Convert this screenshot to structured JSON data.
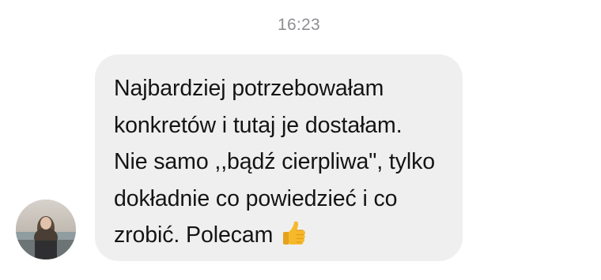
{
  "conversation": {
    "timestamp": "16:23",
    "message": {
      "lines": [
        "Najbardziej potrzebowałam",
        "konkretów i tutaj je dostałam.",
        "Nie samo ,,bądź cierpliwa\", tylko",
        "dokładnie co powiedzieć i co",
        "zrobić. Polecam"
      ],
      "emoji": "thumbs-up-icon"
    },
    "sender": {
      "avatar": "avatar"
    }
  },
  "colors": {
    "bubble_background": "#efefef",
    "timestamp_text": "#8e8e93",
    "message_text": "#141414",
    "emoji_yellow": "#f6b92b"
  }
}
